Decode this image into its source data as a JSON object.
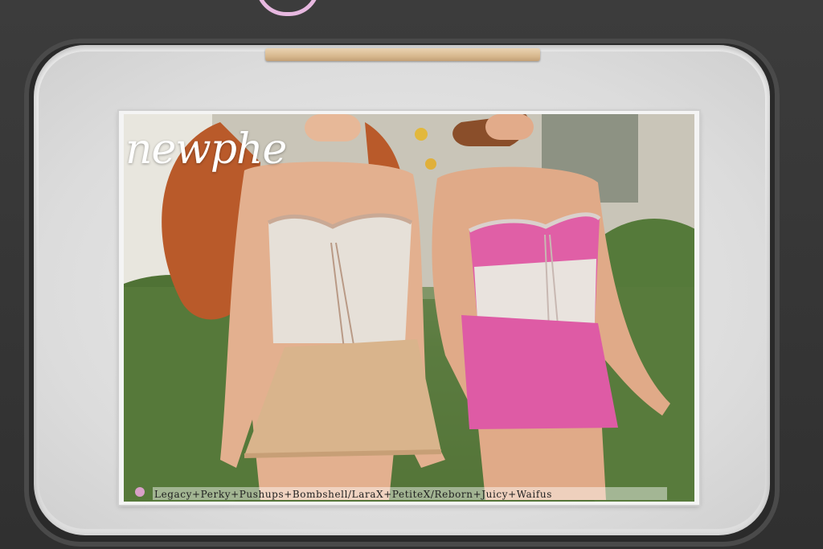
{
  "poster": {
    "brand": "newphe",
    "caption": "Legacy+Perky+Pushups+Bombshell/LaraX+PetiteX/Reborn+Juicy+Waifus"
  },
  "colors": {
    "bezel": "#e6e6e6",
    "wood": "#d8b98f",
    "ornament": "#e7b8e0",
    "top_left_outfit": "#e6e0d8",
    "skirt_left": "#d9b48c",
    "top_right_outfit": "#e05fa6",
    "skirt_right": "#de5ba5"
  }
}
